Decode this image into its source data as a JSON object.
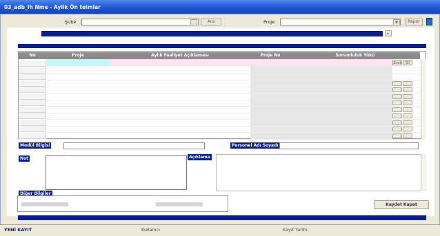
{
  "window": {
    "title": "03_adb_Ih Nme - Aylik Ön teimlar"
  },
  "top": {
    "filter_label": "Şube",
    "search_button": "Ara",
    "project_label": "Proje",
    "report_button": "Rapor",
    "help_icon": "help-icon"
  },
  "table": {
    "columns": [
      "No",
      "Proje",
      "Aylık Faaliyet Açıklaması",
      "Proje No",
      "Sorumluluk Yükü"
    ],
    "small_cols": [
      "Evet",
      "Sil"
    ],
    "row_count": 12
  },
  "fields": {
    "module_label": "Modül Bilgisi",
    "personnel_label": "Personel Adı Soyadı",
    "notes_label": "Not",
    "description_label": "Açıklama",
    "other_label": "Diğer Bilgiler"
  },
  "buttons": {
    "save_button": "Kaydet Kapat"
  },
  "status": {
    "left": "YENİ KAYIT",
    "middle": "Kullanıcı",
    "right": "Kayıt Tarihi"
  },
  "colors": {
    "accent": "#0a1f8e",
    "header": "#8b8b8b",
    "pink": "#fde2f0",
    "cyan": "#c7f6f6"
  }
}
